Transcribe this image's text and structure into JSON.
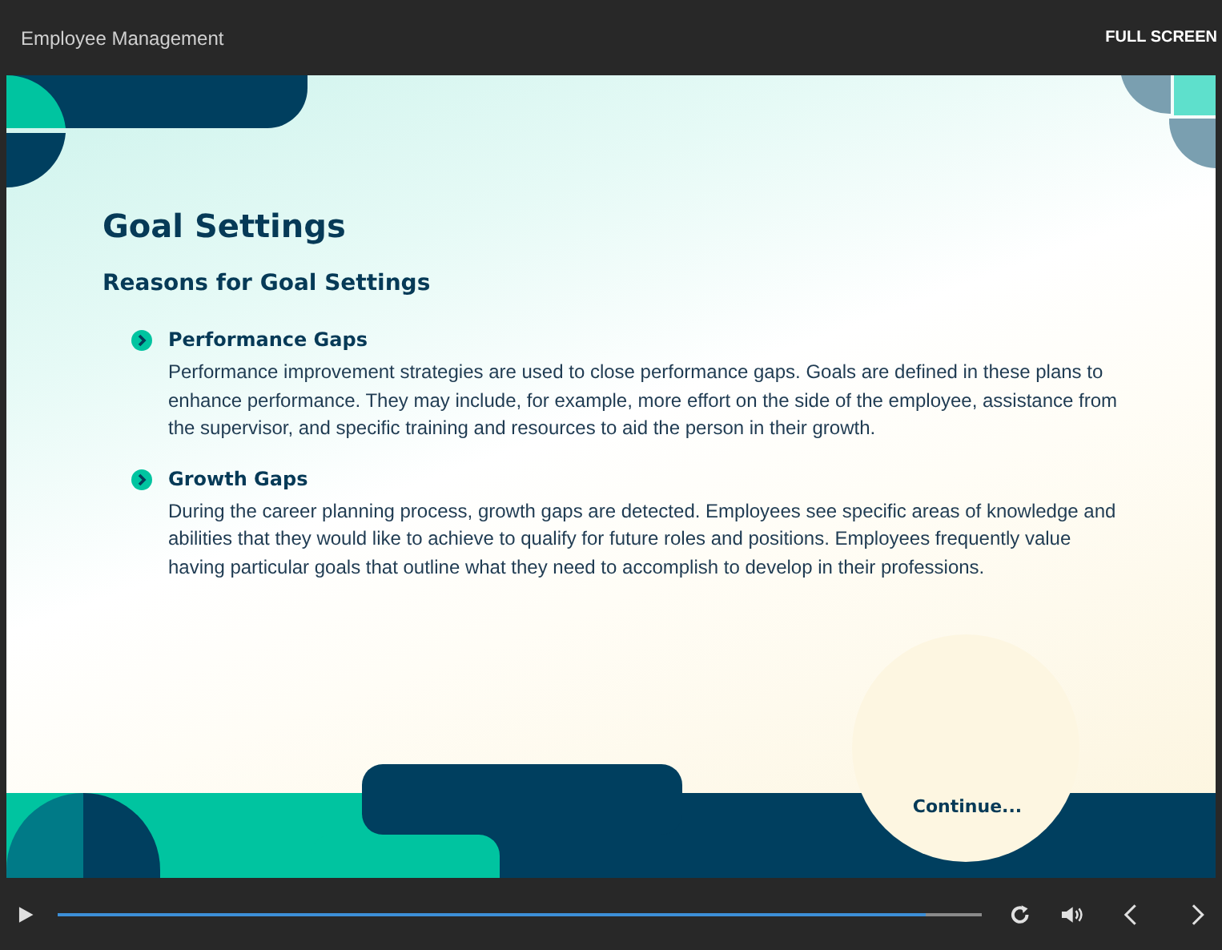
{
  "window": {
    "title": "Employee Management",
    "action": "FULL SCREEN"
  },
  "slide": {
    "title": "Goal Settings",
    "subtitle": "Reasons for Goal Settings",
    "items": [
      {
        "title": "Performance Gaps",
        "body": "Performance improvement strategies are used to close performance gaps. Goals are defined in these plans to enhance performance. They may include, for example, more effort on the side of the employee, assistance from the supervisor, and specific training and resources to aid the person in their growth."
      },
      {
        "title": "Growth Gaps",
        "body": "During the career planning process, growth gaps are detected. Employees see specific areas of knowledge and abilities that they would like to achieve to qualify for future roles and positions. Employees frequently value having particular goals that outline what they need to accomplish to develop in their professions."
      }
    ],
    "continue": "Continue..."
  },
  "player": {
    "progress": {
      "level": 0.94
    }
  }
}
